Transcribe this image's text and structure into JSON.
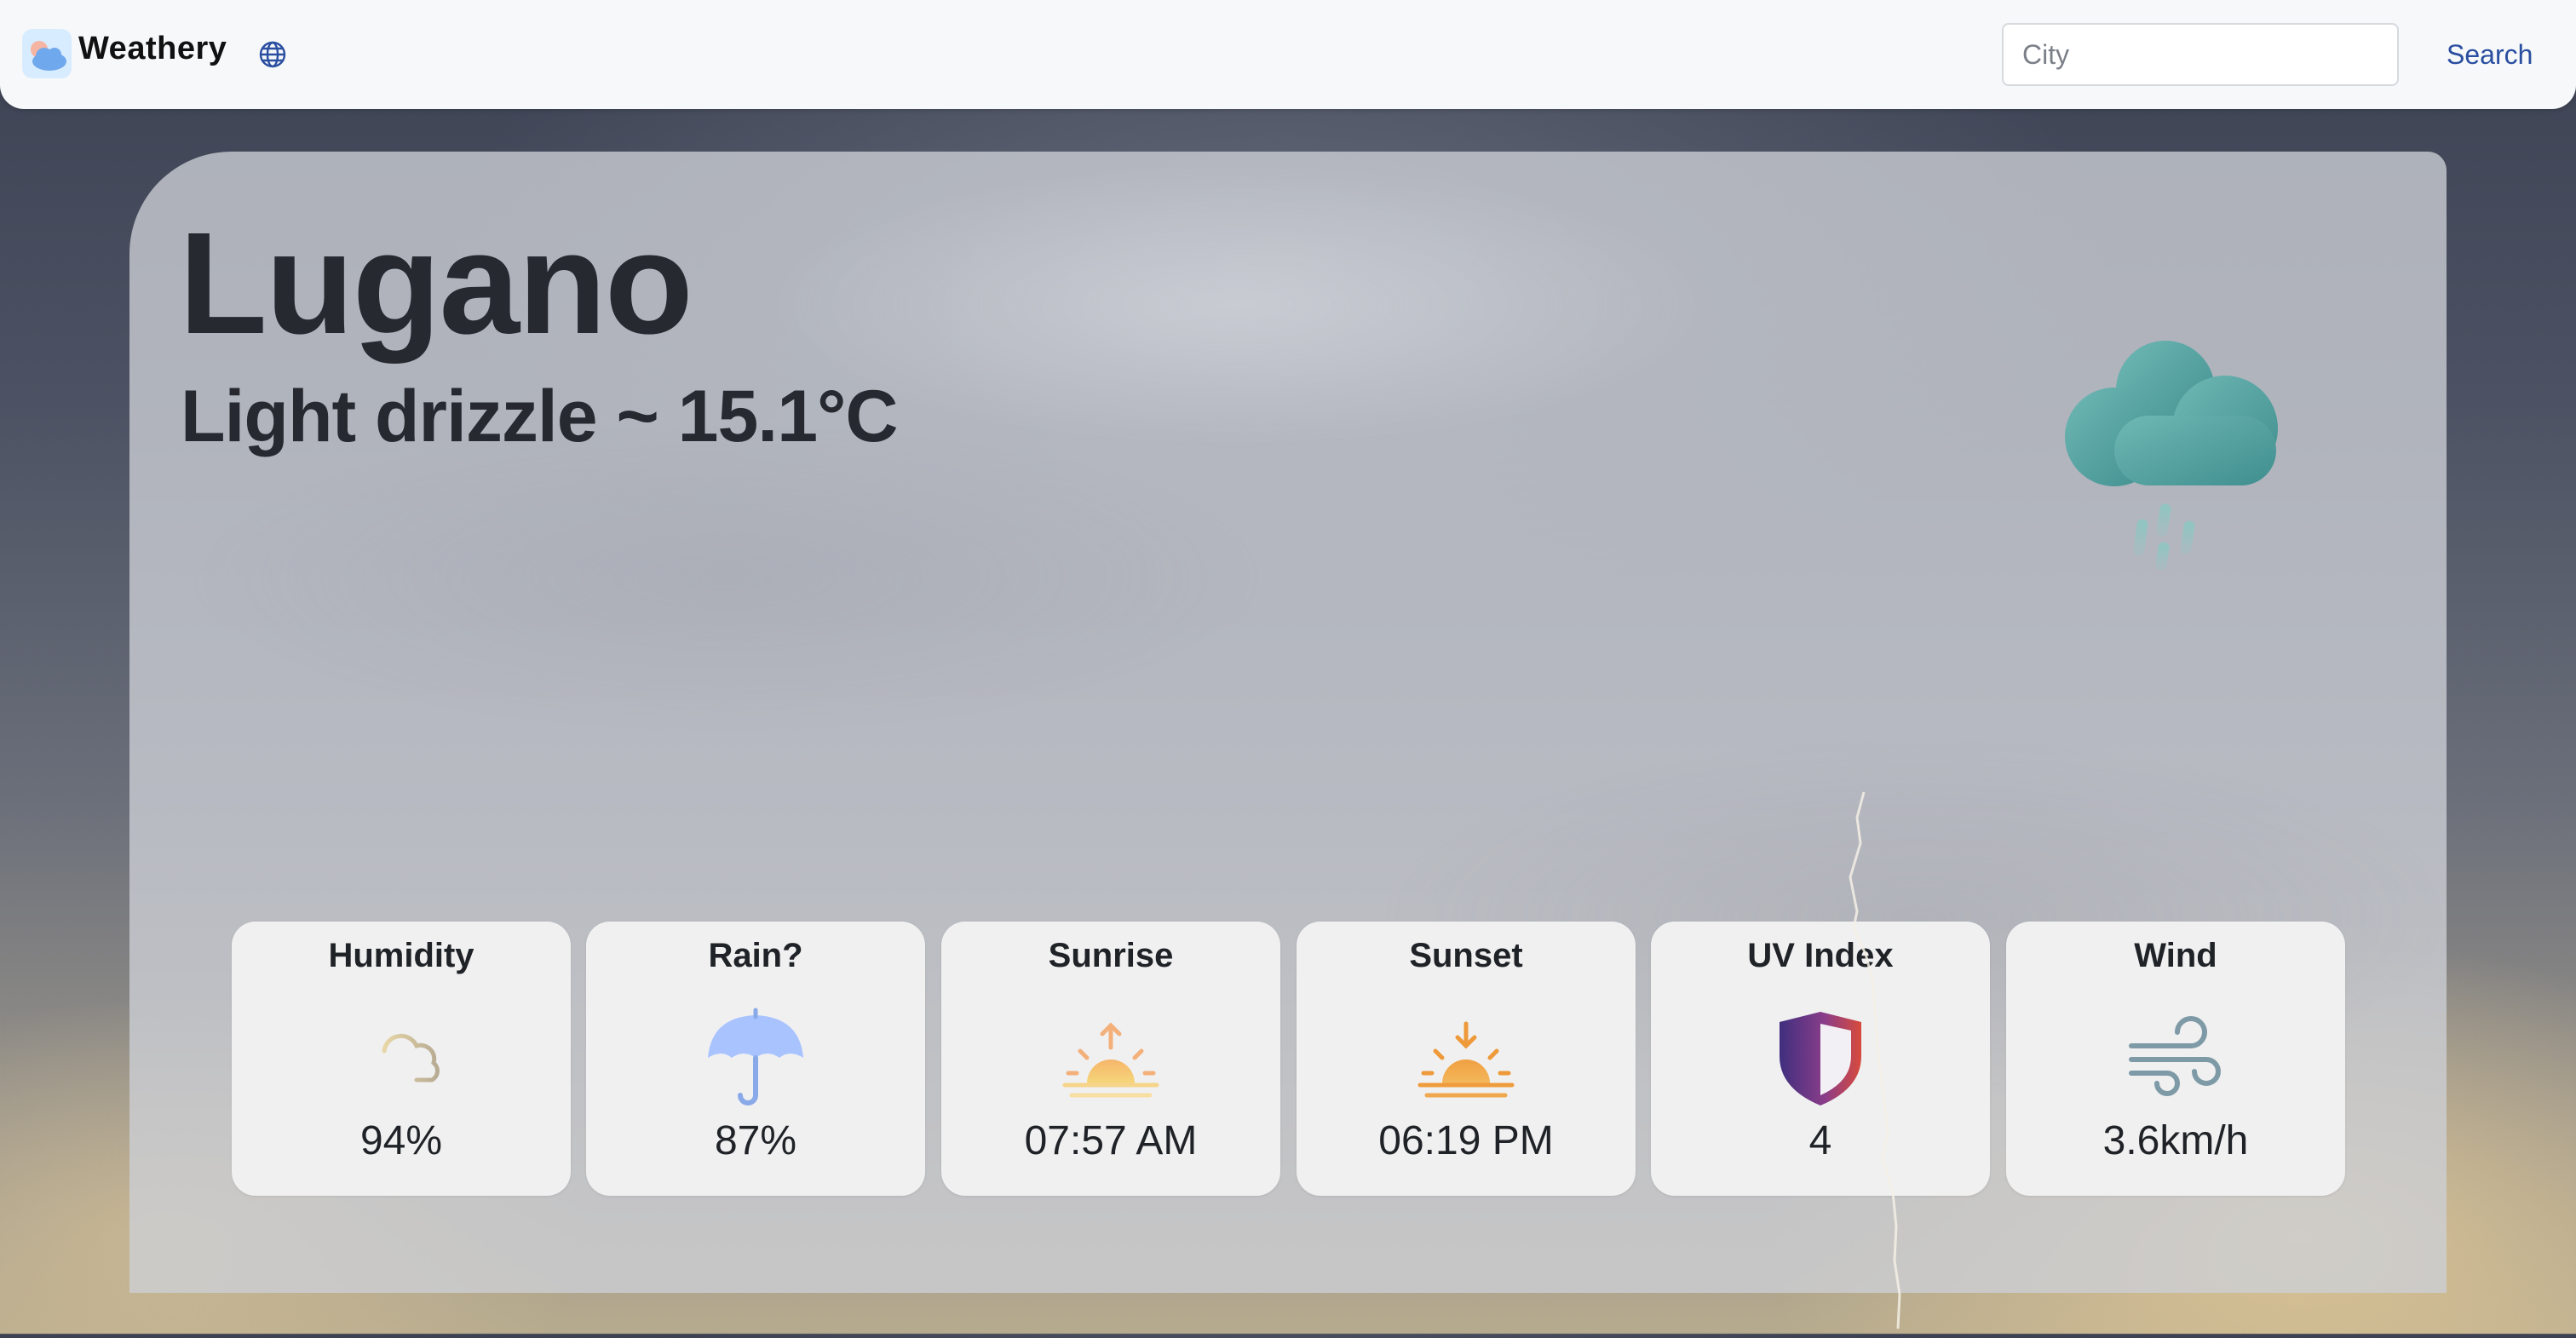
{
  "app": {
    "name": "Weathery",
    "logo_icon": "cloud-sun-logo-icon",
    "language_icon": "globe-icon"
  },
  "search": {
    "placeholder": "City",
    "value": "",
    "button_label": "Search"
  },
  "current": {
    "city": "Lugano",
    "description": "Light drizzle ~ 15.1°C",
    "icon": "cloud-drizzle-icon"
  },
  "cards": [
    {
      "title": "Humidity",
      "value": "94%",
      "icon": "haze-cloud-icon"
    },
    {
      "title": "Rain?",
      "value": "87%",
      "icon": "umbrella-icon"
    },
    {
      "title": "Sunrise",
      "value": "07:57 AM",
      "icon": "sunrise-icon"
    },
    {
      "title": "Sunset",
      "value": "06:19 PM",
      "icon": "sunset-icon"
    },
    {
      "title": "UV Index",
      "value": "4",
      "icon": "shield-icon"
    },
    {
      "title": "Wind",
      "value": "3.6km/h",
      "icon": "wind-icon"
    }
  ],
  "colors": {
    "accent": "#2a4ea0",
    "cloud_icon": "#4a9b9c",
    "umbrella": "#a9c3ff",
    "sun": "#f1a948",
    "shield_left": "#4a2f7a",
    "shield_right": "#d44a3a",
    "wind": "#7d9aa6"
  }
}
